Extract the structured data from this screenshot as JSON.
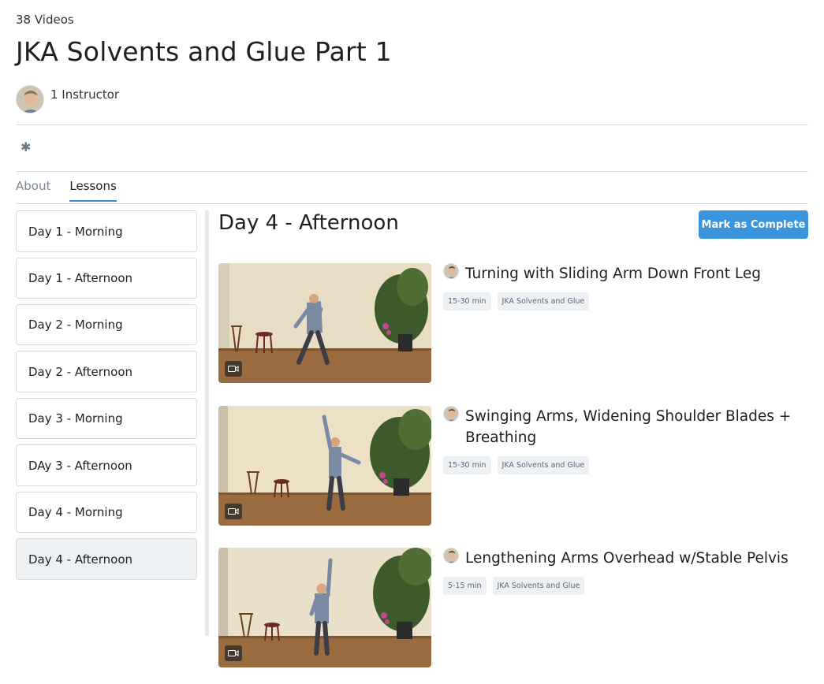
{
  "header": {
    "video_count": "38 Videos",
    "course_title": "JKA Solvents and Glue Part 1",
    "instructor_count": "1 Instructor"
  },
  "tabs": [
    {
      "label": "About",
      "active": false
    },
    {
      "label": "Lessons",
      "active": true
    }
  ],
  "sidebar": {
    "items": [
      {
        "label": "Day 1 - Morning"
      },
      {
        "label": "Day 1 - Afternoon"
      },
      {
        "label": "Day 2 - Morning"
      },
      {
        "label": "Day 2 - Afternoon"
      },
      {
        "label": "Day 3 - Morning"
      },
      {
        "label": "DAy 3 - Afternoon"
      },
      {
        "label": "Day 4 - Morning"
      },
      {
        "label": "Day 4 - Afternoon",
        "selected": true
      }
    ]
  },
  "main": {
    "section_title": "Day 4 - Afternoon",
    "complete_button": "Mark as Complete",
    "videos": [
      {
        "title": "Turning with Sliding Arm Down Front Leg",
        "duration": "15-30 min",
        "course_tag": "JKA Solvents and Glue",
        "thumb_icon": "video-camera-icon"
      },
      {
        "title": "Swinging Arms, Widening Shoulder Blades + Breathing",
        "duration": "15-30 min",
        "course_tag": "JKA Solvents and Glue",
        "thumb_icon": "video-camera-icon"
      },
      {
        "title": "Lengthening Arms Overhead w/Stable Pelvis",
        "duration": "5-15 min",
        "course_tag": "JKA Solvents and Glue",
        "thumb_icon": "video-camera-icon"
      }
    ]
  },
  "colors": {
    "accent": "#3b95dd",
    "tab_underline": "#3b8fd9",
    "selected_item_bg": "#eef1f4"
  }
}
